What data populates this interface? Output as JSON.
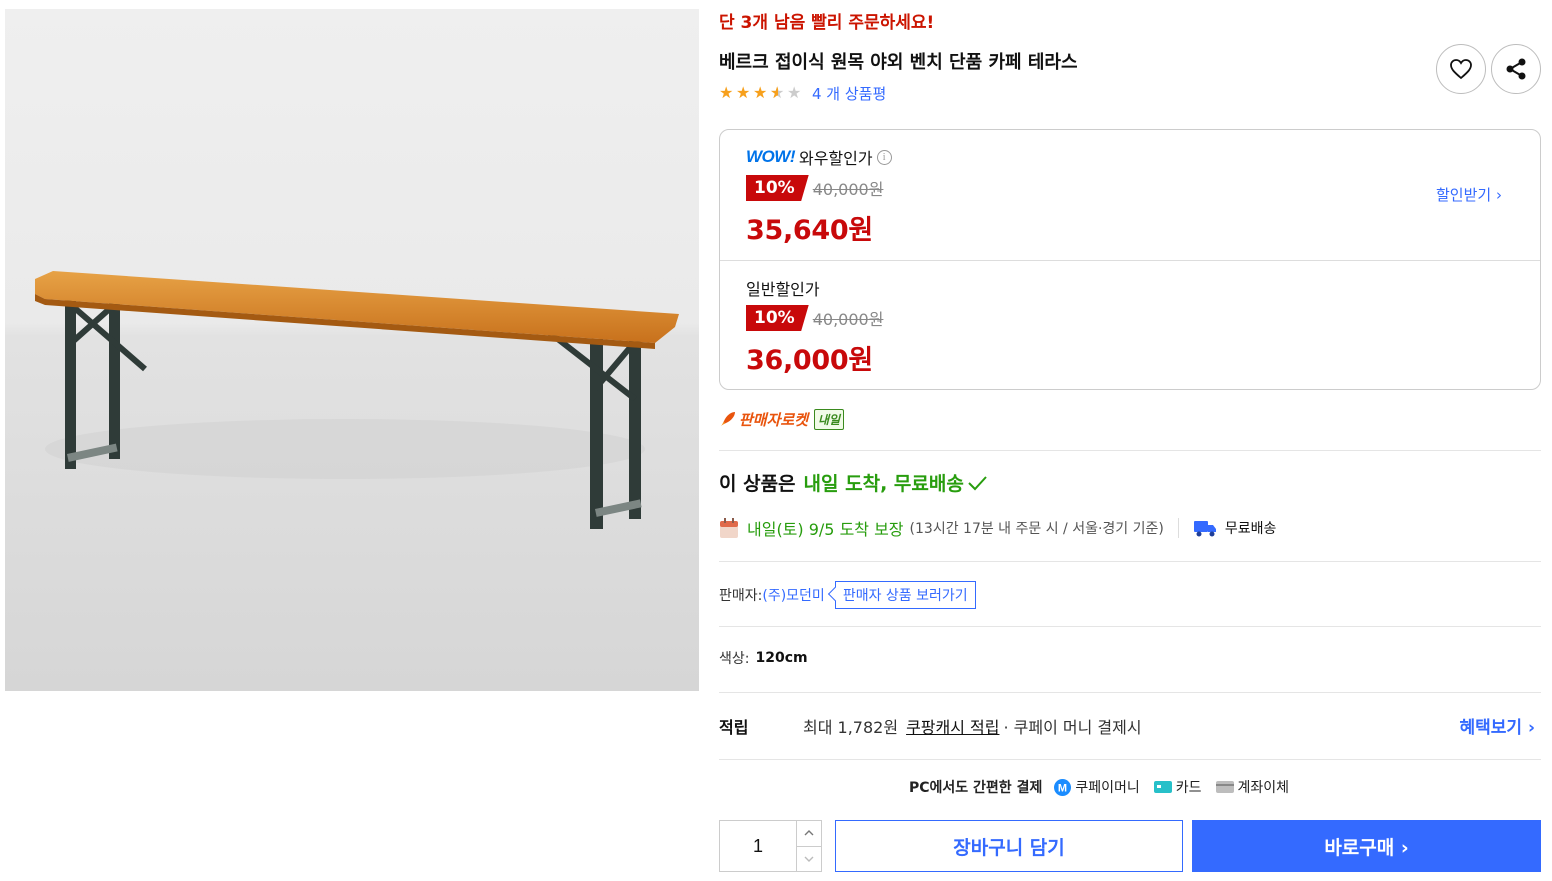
{
  "product": {
    "stock_alert": "단 3개 남음 빨리 주문하세요!",
    "title": "베르크 접이식 원목 야외 벤치 단품 카페 테라스",
    "rating": 3.5,
    "review_count_label": "4 개 상품평"
  },
  "price": {
    "wow": {
      "logo": "WOW!",
      "label": "와우할인가",
      "discount": "10%",
      "original": "40,000원",
      "final": "35,640원",
      "coupon_link": "할인받기 ›"
    },
    "normal": {
      "label": "일반할인가",
      "discount": "10%",
      "original": "40,000원",
      "final": "36,000원"
    }
  },
  "rocket": {
    "label": "판매자로켓",
    "badge": "내일"
  },
  "delivery": {
    "head_prefix": "이 상품은",
    "head_highlight": "내일 도착, 무료배송",
    "arrive": "내일(토) 9/5 도착 보장",
    "arrive_sub": "(13시간 17분 내 주문 시 / 서울·경기 기준)",
    "free_shipping": "무료배송"
  },
  "seller": {
    "label": "판매자: ",
    "name": "(주)모던미",
    "button": "판매자 상품 보러가기"
  },
  "option": {
    "label": "색상:",
    "value": "120cm"
  },
  "reward": {
    "title": "적립",
    "text": "최대 1,782원",
    "link": "쿠팡캐시 적립",
    "tail": "· 쿠페이 머니 결제시",
    "benefit_link": "혜택보기 ›"
  },
  "payment": {
    "title": "PC에서도 간편한 결제",
    "methods": [
      "쿠페이머니",
      "카드",
      "계좌이체"
    ]
  },
  "purchase": {
    "quantity": "1",
    "cart_label": "장바구니 담기",
    "buy_label": "바로구매 ›"
  },
  "colors": {
    "accent": "#346aff",
    "sale_red": "#c8090a",
    "delivery_green": "#289d0e"
  }
}
